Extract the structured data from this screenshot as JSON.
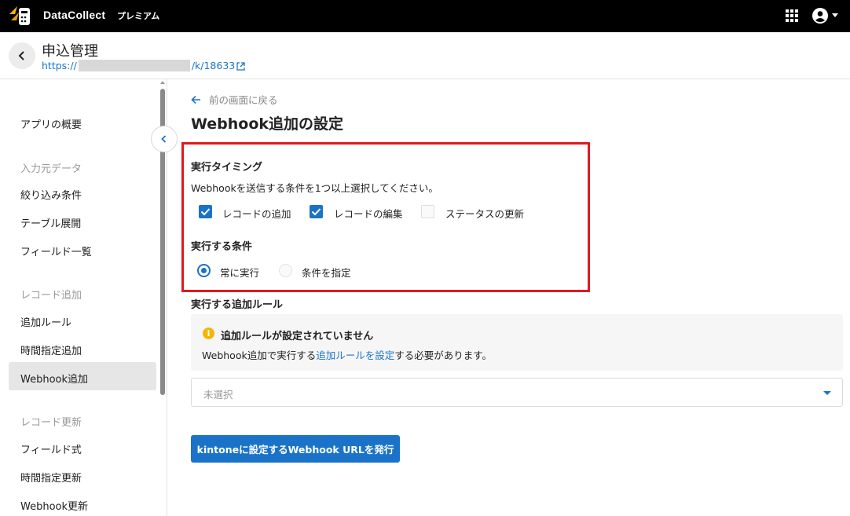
{
  "topbar": {
    "brand": "DataCollect",
    "plan": "プレミアム"
  },
  "app": {
    "title": "申込管理",
    "url_prefix": "https://",
    "url_suffix": "/k/18633"
  },
  "sidebar": {
    "items": [
      {
        "label": "アプリの概要",
        "type": "item"
      },
      {
        "label": "入力元データ",
        "type": "section"
      },
      {
        "label": "絞り込み条件",
        "type": "item"
      },
      {
        "label": "テーブル展開",
        "type": "item"
      },
      {
        "label": "フィールド一覧",
        "type": "item"
      },
      {
        "label": "レコード追加",
        "type": "section"
      },
      {
        "label": "追加ルール",
        "type": "item"
      },
      {
        "label": "時間指定追加",
        "type": "item"
      },
      {
        "label": "Webhook追加",
        "type": "item",
        "active": true
      },
      {
        "label": "レコード更新",
        "type": "section"
      },
      {
        "label": "フィールド式",
        "type": "item"
      },
      {
        "label": "時間指定更新",
        "type": "item"
      },
      {
        "label": "Webhook更新",
        "type": "item"
      }
    ]
  },
  "main": {
    "back_label": "前の画面に戻る",
    "page_title": "Webhook追加の設定",
    "timing": {
      "title": "実行タイミング",
      "description": "Webhookを送信する条件を1つ以上選択してください。",
      "options": [
        {
          "label": "レコードの追加",
          "checked": true
        },
        {
          "label": "レコードの編集",
          "checked": true
        },
        {
          "label": "ステータスの更新",
          "checked": false
        }
      ]
    },
    "condition": {
      "title": "実行する条件",
      "options": [
        {
          "label": "常に実行",
          "selected": true
        },
        {
          "label": "条件を指定",
          "selected": false
        }
      ]
    },
    "rule": {
      "title": "実行する追加ルール",
      "alert_title": "追加ルールが設定されていません",
      "alert_body_before": "Webhook追加で実行する",
      "alert_link": "追加ルールを設定",
      "alert_body_after": "する必要があります。",
      "select_value": "未選択"
    },
    "issue_button": "kintoneに設定するWebhook URLを発行"
  },
  "colors": {
    "accent": "#1a73c8",
    "highlight_border": "#e1191f",
    "topbar_bg": "#000000",
    "warning": "#f2b705"
  }
}
